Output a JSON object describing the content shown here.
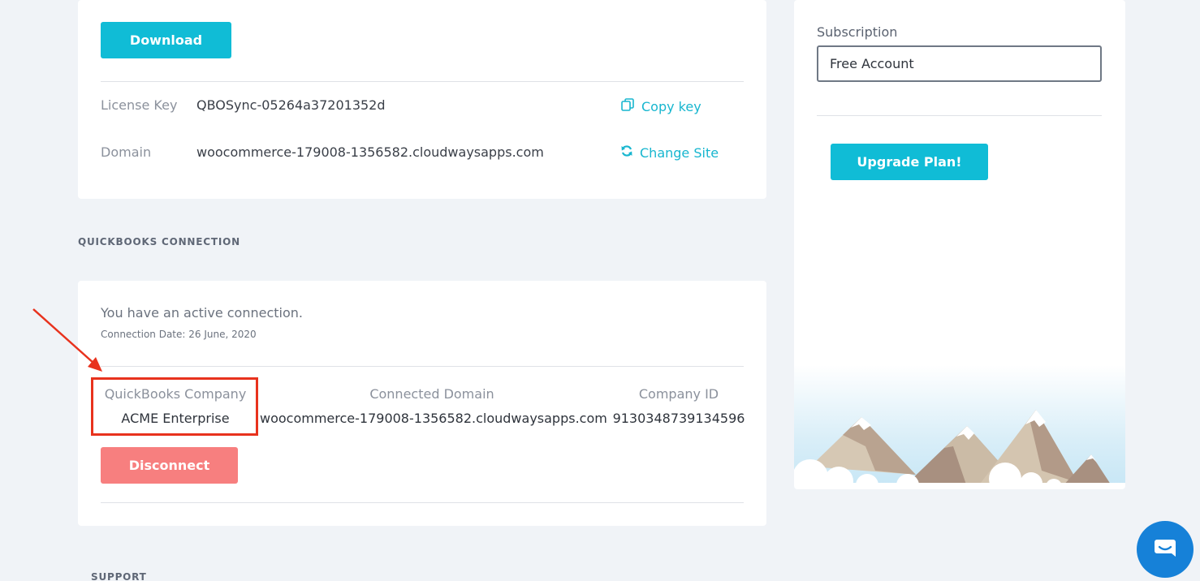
{
  "license_card": {
    "download_label": "Download",
    "rows": [
      {
        "label": "License Key",
        "value": "QBOSync-05264a37201352d",
        "action": "Copy key",
        "action_icon": "copy-icon"
      },
      {
        "label": "Domain",
        "value": "woocommerce-179008-1356582.cloudwaysapps.com",
        "action": "Change Site",
        "action_icon": "refresh-icon"
      }
    ]
  },
  "qb_section": {
    "title": "QUICKBOOKS CONNECTION",
    "status_text": "You have an active connection.",
    "connection_date": "Connection Date: 26 June, 2020",
    "columns": [
      {
        "header": "QuickBooks Company",
        "value": "ACME Enterprise"
      },
      {
        "header": "Connected Domain",
        "value": "woocommerce-179008-1356582.cloudwaysapps.com"
      },
      {
        "header": "Company ID",
        "value": "9130348739134596"
      }
    ],
    "disconnect_label": "Disconnect"
  },
  "subscription": {
    "label": "Subscription",
    "selected": "Free Account",
    "upgrade_label": "Upgrade Plan!"
  },
  "support_section": {
    "title": "SUPPORT"
  },
  "colors": {
    "accent": "#10bcd6",
    "danger_button": "#f77f7f",
    "annotation": "#e8321d",
    "chat": "#1681d8"
  }
}
